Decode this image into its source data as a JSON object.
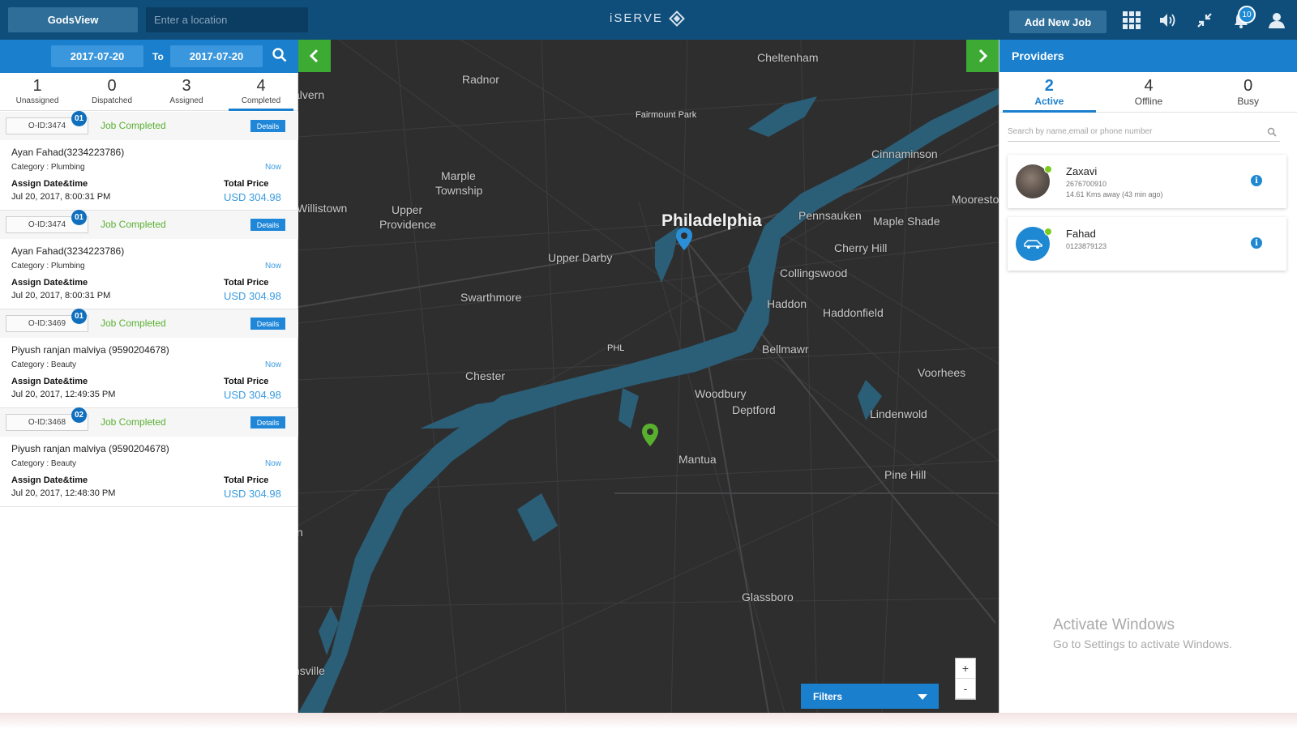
{
  "header": {
    "gods_view_label": "GodsView",
    "location_placeholder": "Enter a location",
    "brand": "iSERVE",
    "add_job_label": "Add New Job",
    "notification_count": "10",
    "icons": [
      "apps-grid-icon",
      "volume-icon",
      "compress-icon",
      "bell-icon",
      "user-icon"
    ]
  },
  "date_filter": {
    "from": "2017-07-20",
    "to_label": "To",
    "to": "2017-07-20"
  },
  "status_tabs": [
    {
      "count": "1",
      "label": "Unassigned"
    },
    {
      "count": "0",
      "label": "Dispatched"
    },
    {
      "count": "3",
      "label": "Assigned"
    },
    {
      "count": "4",
      "label": "Completed"
    }
  ],
  "jobs": [
    {
      "order_id": "O-ID:3474",
      "badge": "01",
      "status": "Job Completed",
      "details_label": "Details",
      "customer": "Ayan Fahad(3234223786)",
      "category": "Category : Plumbing",
      "time_tag": "Now",
      "assign_label": "Assign Date&time",
      "assign_value": "Jul 20, 2017, 8:00:31 PM",
      "price_label": "Total Price",
      "price_value": "USD 304.98"
    },
    {
      "order_id": "O-ID:3474",
      "badge": "01",
      "status": "Job Completed",
      "details_label": "Details",
      "customer": "Ayan Fahad(3234223786)",
      "category": "Category : Plumbing",
      "time_tag": "Now",
      "assign_label": "Assign Date&time",
      "assign_value": "Jul 20, 2017, 8:00:31 PM",
      "price_label": "Total Price",
      "price_value": "USD 304.98"
    },
    {
      "order_id": "O-ID:3469",
      "badge": "01",
      "status": "Job Completed",
      "details_label": "Details",
      "customer": "Piyush ranjan malviya (9590204678)",
      "category": "Category : Beauty",
      "time_tag": "Now",
      "assign_label": "Assign Date&time",
      "assign_value": "Jul 20, 2017, 12:49:35 PM",
      "price_label": "Total Price",
      "price_value": "USD 304.98"
    },
    {
      "order_id": "O-ID:3468",
      "badge": "02",
      "status": "Job Completed",
      "details_label": "Details",
      "customer": "Piyush ranjan malviya (9590204678)",
      "category": "Category : Beauty",
      "time_tag": "Now",
      "assign_label": "Assign Date&time",
      "assign_value": "Jul 20, 2017, 12:48:30 PM",
      "price_label": "Total Price",
      "price_value": "USD 304.98"
    }
  ],
  "map": {
    "labels": [
      "Cheltenham",
      "Radnor",
      "alvern",
      "Fairmount Park",
      "Cinnaminson",
      "Marple",
      "Township",
      "Willistown",
      "Upper",
      "Providence",
      "Philadelphia",
      "Pennsauken",
      "Maple Shade",
      "Moorestο",
      "Cherry Hill",
      "Upper Darby",
      "Collingswood",
      "Swarthmore",
      "Haddon",
      "Haddonfield",
      "PHL",
      "Bellmawr",
      "Chester",
      "Voorhees",
      "Woodbury",
      "Deptford",
      "Lindenwold",
      "Mantua",
      "Pine Hill",
      "Glassboro",
      "n",
      "nsville"
    ],
    "zoom_in": "+",
    "zoom_out": "-",
    "filters_label": "Filters",
    "water_color": "#2b5f78",
    "land_color": "#2e2e2f"
  },
  "providers": {
    "title": "Providers",
    "tabs": [
      {
        "count": "2",
        "label": "Active"
      },
      {
        "count": "4",
        "label": "Offline"
      },
      {
        "count": "0",
        "label": "Busy"
      }
    ],
    "search_placeholder": "Search by name,email or phone number",
    "list": [
      {
        "name": "Zaxavi",
        "phone": "2676700910",
        "distance": "14.61 Kms away (43 min ago)"
      },
      {
        "name": "Fahad",
        "phone": "0123879123",
        "distance": ""
      }
    ]
  },
  "watermark": {
    "title": "Activate Windows",
    "subtitle": "Go to Settings to activate Windows."
  },
  "colors": {
    "header_bg": "#0f4e7b",
    "accent_blue": "#1a7fcd",
    "toggle_green": "#3caa33",
    "status_green": "#59b131",
    "online_dot": "#7ccc1e"
  }
}
